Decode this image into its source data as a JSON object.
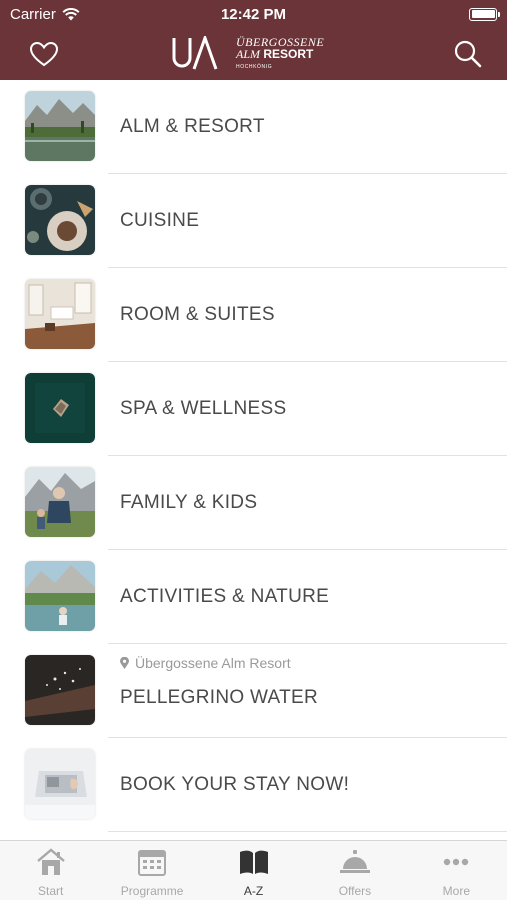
{
  "status_bar": {
    "carrier": "Carrier",
    "time": "12:42 PM"
  },
  "header": {
    "logo": {
      "mark": "UA",
      "line1": "ÜBERGOSSENE",
      "line2_italic": "ALM",
      "line2_bold": "RESORT",
      "line3": "HOCHKÖNIG"
    }
  },
  "list": [
    {
      "title": "ALM & RESORT",
      "thumb": "mountain-lake"
    },
    {
      "title": "CUISINE",
      "thumb": "food-plates"
    },
    {
      "title": "ROOM & SUITES",
      "thumb": "hotel-room"
    },
    {
      "title": "SPA & WELLNESS",
      "thumb": "aerial-pool"
    },
    {
      "title": "FAMILY & KIDS",
      "thumb": "family-meadow"
    },
    {
      "title": "ACTIVITIES & NATURE",
      "thumb": "mountain-pond"
    },
    {
      "title": "PELLEGRINO WATER",
      "subtitle": "Übergossene Alm Resort",
      "thumb": "water-splash"
    },
    {
      "title": "BOOK YOUR STAY NOW!",
      "thumb": "laptop-desk"
    }
  ],
  "tabs": [
    {
      "label": "Start",
      "icon": "home-icon",
      "active": false
    },
    {
      "label": "Programme",
      "icon": "calendar-icon",
      "active": false
    },
    {
      "label": "A-Z",
      "icon": "book-icon",
      "active": true
    },
    {
      "label": "Offers",
      "icon": "service-bell-icon",
      "active": false
    },
    {
      "label": "More",
      "icon": "more-dots-icon",
      "active": false
    }
  ],
  "colors": {
    "header_bg": "#6b3438",
    "tab_active": "#3a3a3a",
    "tab_inactive": "#a8a8a8",
    "text": "#4a4a4a"
  }
}
